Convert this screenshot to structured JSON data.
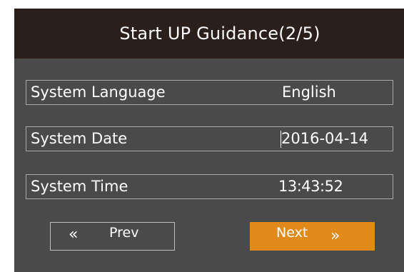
{
  "dialog": {
    "title": "Start UP Guidance(2/5)"
  },
  "settings": {
    "language": {
      "label": "System Language",
      "value": "English"
    },
    "date": {
      "label": "System Date",
      "value": "2016-04-14"
    },
    "time": {
      "label": "System Time",
      "value": "13:43:52"
    }
  },
  "buttons": {
    "prev": {
      "label": "Prev",
      "icon": "double-chevron-left-icon",
      "glyph": "«"
    },
    "next": {
      "label": "Next",
      "icon": "double-chevron-right-icon",
      "glyph": "»"
    }
  },
  "colors": {
    "title_bar": "#2b1f1c",
    "panel": "#4a4a4a",
    "accent": "#e08a1c",
    "text": "#ffffff"
  }
}
